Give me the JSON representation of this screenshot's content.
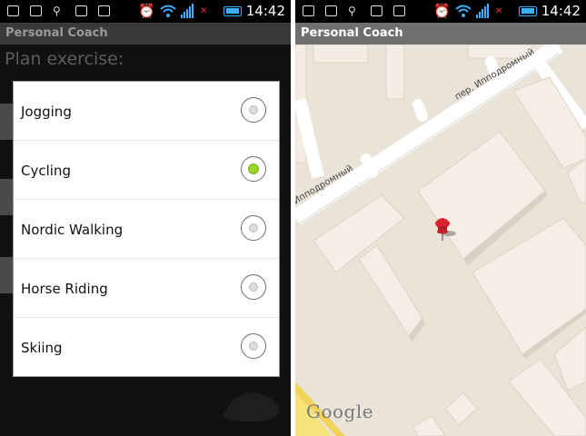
{
  "status_bar": {
    "time": "14:42",
    "icons": [
      "usb-debug-icon",
      "sdcard-icon",
      "usb-icon",
      "download-icon",
      "notification-icon",
      "alarm-icon",
      "wifi-icon",
      "signal-icon",
      "no-signal-icon",
      "battery-icon"
    ]
  },
  "left_screen": {
    "app_title": "Personal Coach",
    "background_heading": "Plan exercise:",
    "dialog": {
      "options": [
        {
          "label": "Jogging",
          "selected": false
        },
        {
          "label": "Cycling",
          "selected": true
        },
        {
          "label": "Nordic Walking",
          "selected": false
        },
        {
          "label": "Horse Riding",
          "selected": false
        },
        {
          "label": "Skiing",
          "selected": false
        }
      ]
    }
  },
  "right_screen": {
    "app_title": "Personal Coach",
    "map": {
      "street_labels": [
        "пер. Ипподромный",
        "Ипподромный"
      ],
      "attribution": "Google",
      "marker": "map-pin-icon"
    }
  },
  "colors": {
    "radio_selected": "#9bd32a",
    "status_accent": "#3ab0ff",
    "map_background": "#eae3d8"
  }
}
